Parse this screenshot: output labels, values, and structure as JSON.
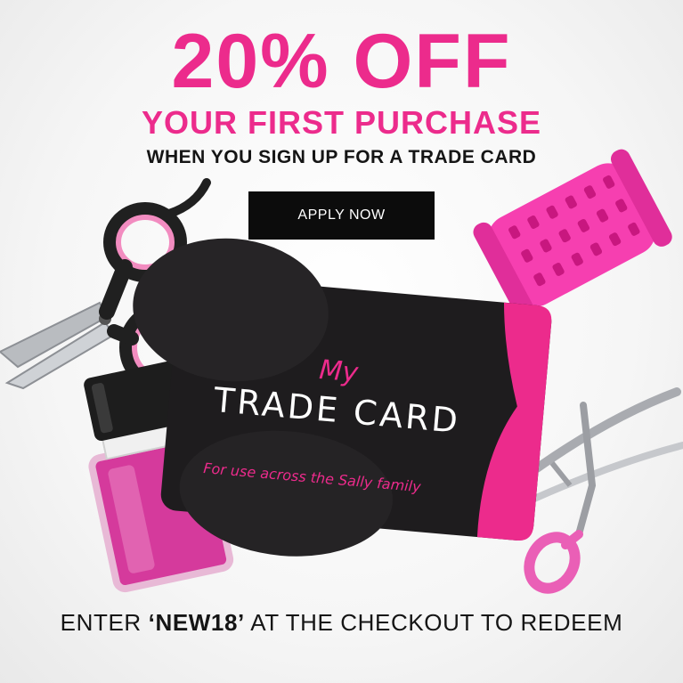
{
  "headline": {
    "discount": "20% OFF",
    "subtitle": "YOUR FIRST PURCHASE",
    "tagline": "WHEN YOU SIGN UP FOR A TRADE CARD"
  },
  "cta": {
    "label": "APPLY NOW"
  },
  "card": {
    "script_word": "My",
    "title": "TRADE CARD",
    "subtitle": "For use across the Sally family"
  },
  "footer": {
    "prefix": "ENTER ",
    "code": "‘NEW18’",
    "suffix": " AT THE CHECKOUT TO REDEEM"
  },
  "icons": [
    "scissors-icon",
    "hair-roller-icon",
    "nail-polish-icon",
    "eyelash-curler-icon"
  ],
  "colors": {
    "brand_pink": "#ec2b8c",
    "card_black": "#1e1c1e",
    "button_black": "#0c0c0c"
  }
}
